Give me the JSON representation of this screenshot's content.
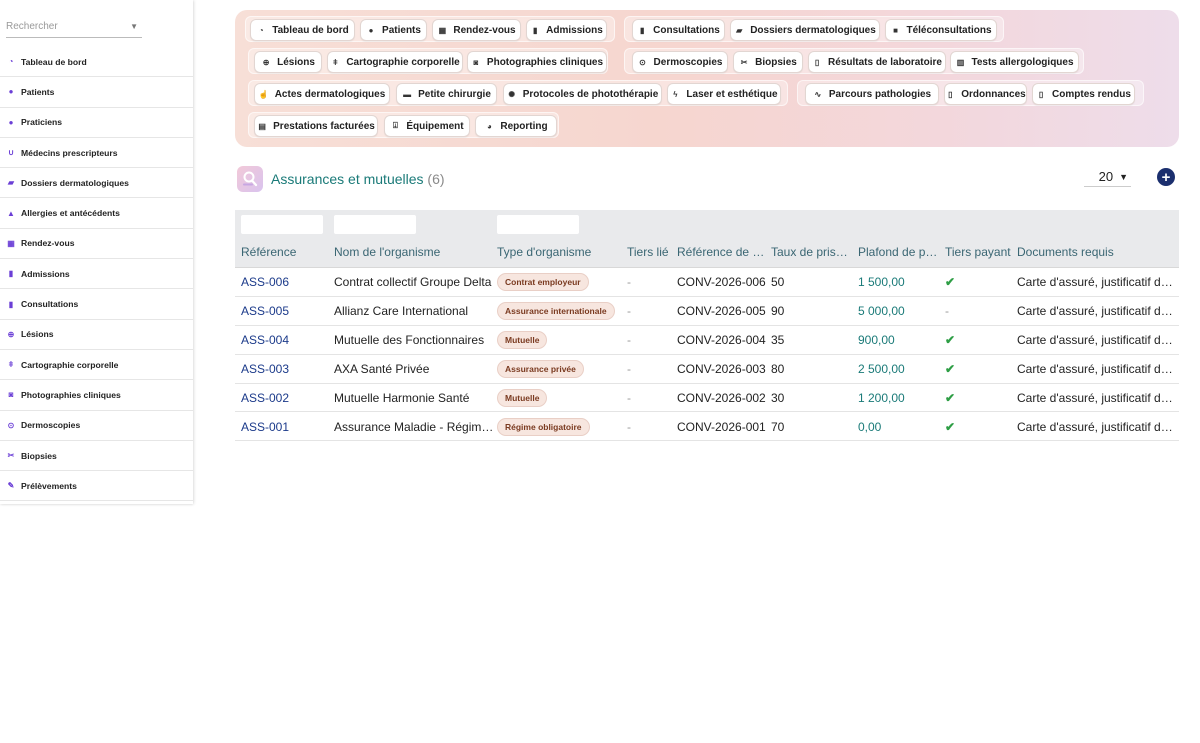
{
  "search": {
    "placeholder": "Rechercher"
  },
  "sidebar": {
    "items": [
      {
        "label": "Tableau de bord",
        "icon": "gauge-icon"
      },
      {
        "label": "Patients",
        "icon": "user-icon"
      },
      {
        "label": "Praticiens",
        "icon": "user-doctor-icon"
      },
      {
        "label": "Médecins prescripteurs",
        "icon": "stethoscope-icon"
      },
      {
        "label": "Dossiers dermatologiques",
        "icon": "folder-open-icon"
      },
      {
        "label": "Allergies et antécédents",
        "icon": "warning-icon"
      },
      {
        "label": "Rendez-vous",
        "icon": "calendar-icon"
      },
      {
        "label": "Admissions",
        "icon": "clipboard-icon"
      },
      {
        "label": "Consultations",
        "icon": "clipboard-icon"
      },
      {
        "label": "Lésions",
        "icon": "circle-plus-icon"
      },
      {
        "label": "Cartographie corporelle",
        "icon": "person-icon"
      },
      {
        "label": "Photographies cliniques",
        "icon": "camera-icon"
      },
      {
        "label": "Dermoscopies",
        "icon": "magnifier-icon"
      },
      {
        "label": "Biopsies",
        "icon": "scissors-icon"
      },
      {
        "label": "Prélèvements",
        "icon": "syringe-icon"
      }
    ]
  },
  "toolbar": {
    "buttons": [
      {
        "label": "Tableau de bord",
        "icon": "gauge-icon"
      },
      {
        "label": "Patients",
        "icon": "user-icon"
      },
      {
        "label": "Rendez-vous",
        "icon": "calendar-icon"
      },
      {
        "label": "Admissions",
        "icon": "clipboard-icon"
      },
      {
        "label": "Consultations",
        "icon": "clipboard-icon"
      },
      {
        "label": "Dossiers dermatologiques",
        "icon": "folder-open-icon"
      },
      {
        "label": "Téléconsultations",
        "icon": "video-icon"
      },
      {
        "label": "Lésions",
        "icon": "circle-plus-icon"
      },
      {
        "label": "Cartographie corporelle",
        "icon": "person-icon"
      },
      {
        "label": "Photographies cliniques",
        "icon": "camera-icon"
      },
      {
        "label": "Dermoscopies",
        "icon": "magnifier-icon"
      },
      {
        "label": "Biopsies",
        "icon": "scissors-icon"
      },
      {
        "label": "Résultats de laboratoire",
        "icon": "file-icon"
      },
      {
        "label": "Tests allergologiques",
        "icon": "vial-icon"
      },
      {
        "label": "Actes dermatologiques",
        "icon": "hand-icon"
      },
      {
        "label": "Petite chirurgie",
        "icon": "bed-icon"
      },
      {
        "label": "Protocoles de photothérapie",
        "icon": "sun-icon"
      },
      {
        "label": "Laser et esthétique",
        "icon": "bolt-icon"
      },
      {
        "label": "Parcours pathologies",
        "icon": "route-icon"
      },
      {
        "label": "Ordonnances",
        "icon": "file-icon"
      },
      {
        "label": "Comptes rendus",
        "icon": "file-icon"
      },
      {
        "label": "Prestations facturées",
        "icon": "file-invoice-icon"
      },
      {
        "label": "Équipement",
        "icon": "equipment-icon"
      },
      {
        "label": "Reporting",
        "icon": "pie-chart-icon"
      }
    ]
  },
  "header": {
    "title": "Assurances et mutuelles",
    "count": "(6)",
    "per_page": "20",
    "add_label": "+"
  },
  "table": {
    "columns": [
      "Référence",
      "Nom de l'organisme",
      "Type d'organisme",
      "Tiers lié",
      "Référence de convention",
      "Taux de prise en charge",
      "Plafond de prise en charge",
      "Tiers payant",
      "Documents requis"
    ],
    "columns_display": [
      "Référence",
      "Nom de l'organisme",
      "Type d'organisme",
      "Tiers lié",
      "Référence de …",
      "Taux de pris…",
      "Plafond de p…",
      "Tiers payant",
      "Documents requis"
    ],
    "rows": [
      {
        "ref": "ASS-006",
        "name": "Contrat collectif Groupe Delta",
        "type": "Contrat employeur",
        "tiers": "-",
        "conv": "CONV-2026-006",
        "taux": "50",
        "plafond": "1 500,00",
        "tiers_payant": true,
        "docs": "Carte d'assuré, justificatif de…"
      },
      {
        "ref": "ASS-005",
        "name": "Allianz Care International",
        "type": "Assurance internationale",
        "tiers": "-",
        "conv": "CONV-2026-005",
        "taux": "90",
        "plafond": "5 000,00",
        "tiers_payant": false,
        "docs": "Carte d'assuré, justificatif de…"
      },
      {
        "ref": "ASS-004",
        "name": "Mutuelle des Fonctionnaires",
        "type": "Mutuelle",
        "tiers": "-",
        "conv": "CONV-2026-004",
        "taux": "35",
        "plafond": "900,00",
        "tiers_payant": true,
        "docs": "Carte d'assuré, justificatif de…"
      },
      {
        "ref": "ASS-003",
        "name": "AXA Santé Privée",
        "type": "Assurance privée",
        "tiers": "-",
        "conv": "CONV-2026-003",
        "taux": "80",
        "plafond": "2 500,00",
        "tiers_payant": true,
        "docs": "Carte d'assuré, justificatif de…"
      },
      {
        "ref": "ASS-002",
        "name": "Mutuelle Harmonie Santé",
        "type": "Mutuelle",
        "tiers": "-",
        "conv": "CONV-2026-002",
        "taux": "30",
        "plafond": "1 200,00",
        "tiers_payant": true,
        "docs": "Carte d'assuré, justificatif de…"
      },
      {
        "ref": "ASS-001",
        "name": "Assurance Maladie - Régim…",
        "type": "Régime obligatoire",
        "tiers": "-",
        "conv": "CONV-2026-001",
        "taux": "70",
        "plafond": "0,00",
        "tiers_payant": true,
        "docs": "Carte d'assuré, justificatif de…"
      }
    ],
    "check_symbol": "✔",
    "no_symbol": "-"
  }
}
